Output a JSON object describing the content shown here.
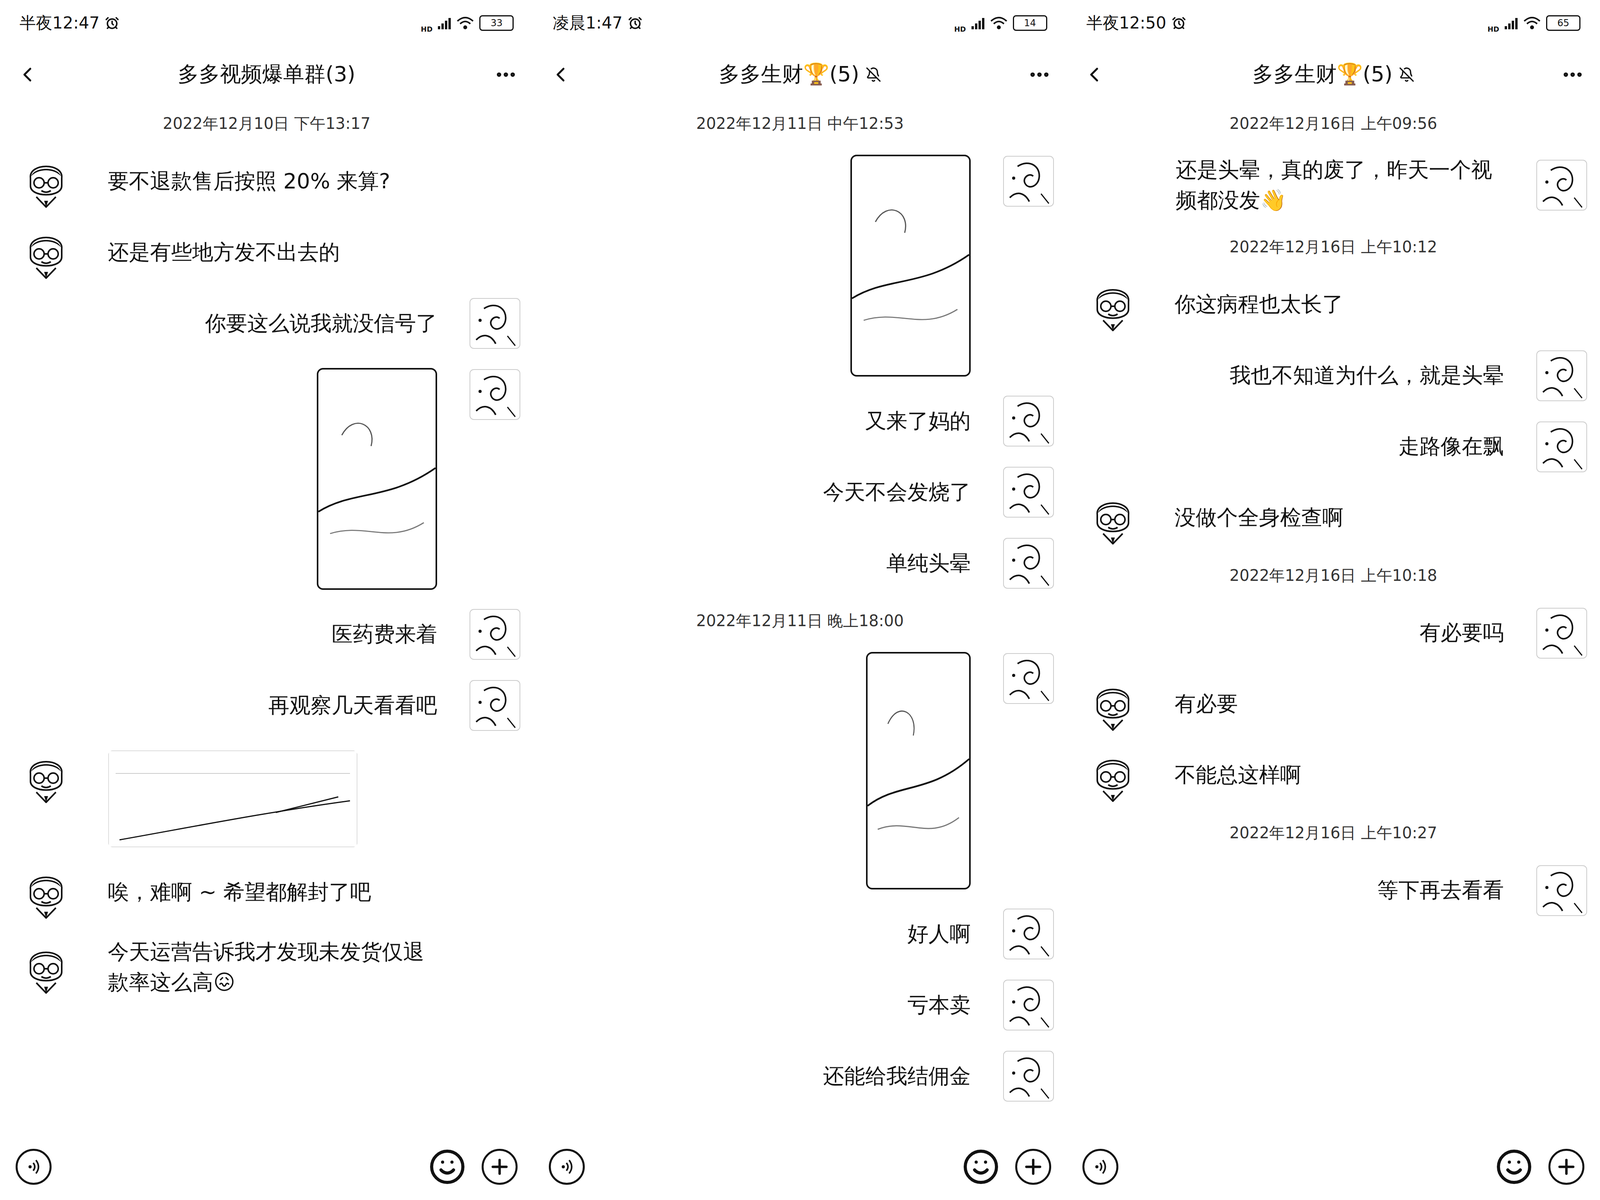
{
  "panels": [
    {
      "status_bar": {
        "time": "半夜12:47",
        "network": "HD",
        "battery": "33"
      },
      "title": "多多视频爆单群(3)",
      "muted": false,
      "messages": [
        {
          "kind": "time",
          "text": "2022年12月10日 下午13:17"
        },
        {
          "kind": "text",
          "side": "left",
          "text": "要不退款售后按照 20% 来算?"
        },
        {
          "kind": "text",
          "side": "left",
          "text": "还是有些地方发不出去的"
        },
        {
          "kind": "text",
          "side": "right",
          "text": "你要这么说我就没信号了"
        },
        {
          "kind": "photo",
          "side": "right"
        },
        {
          "kind": "text",
          "side": "right",
          "text": "医药费来着"
        },
        {
          "kind": "text",
          "side": "right",
          "text": "再观察几天看看吧"
        },
        {
          "kind": "chart",
          "side": "left"
        },
        {
          "kind": "text",
          "side": "left",
          "text": "唉，难啊 ~ 希望都解封了吧"
        },
        {
          "kind": "text",
          "side": "left",
          "text": "今天运营告诉我才发现未发货仅退款率这么高😖"
        }
      ]
    },
    {
      "status_bar": {
        "time": "凌晨1:47",
        "network": "HD",
        "battery": "14"
      },
      "title": "多多生财🏆(5)",
      "muted": true,
      "messages": [
        {
          "kind": "time",
          "text": "2022年12月11日 中午12:53"
        },
        {
          "kind": "photo",
          "side": "right"
        },
        {
          "kind": "text",
          "side": "right",
          "text": "又来了妈的"
        },
        {
          "kind": "text",
          "side": "right",
          "text": "今天不会发烧了"
        },
        {
          "kind": "text",
          "side": "right",
          "text": "单纯头晕"
        },
        {
          "kind": "time",
          "text": "2022年12月11日 晚上18:00"
        },
        {
          "kind": "screenshot",
          "side": "right"
        },
        {
          "kind": "text",
          "side": "right",
          "text": "好人啊"
        },
        {
          "kind": "text",
          "side": "right",
          "text": "亏本卖"
        },
        {
          "kind": "text",
          "side": "right",
          "text": "还能给我结佣金"
        }
      ]
    },
    {
      "status_bar": {
        "time": "半夜12:50",
        "network": "HD",
        "battery": "65"
      },
      "title": "多多生财🏆(5)",
      "muted": true,
      "messages": [
        {
          "kind": "time",
          "text": "2022年12月16日 上午09:56"
        },
        {
          "kind": "text",
          "side": "right",
          "text": "还是头晕，真的废了，昨天一个视频都没发👋"
        },
        {
          "kind": "time",
          "text": "2022年12月16日 上午10:12"
        },
        {
          "kind": "text",
          "side": "left",
          "text": "你这病程也太长了"
        },
        {
          "kind": "text",
          "side": "right",
          "text": "我也不知道为什么，就是头晕"
        },
        {
          "kind": "text",
          "side": "right",
          "text": "走路像在飘"
        },
        {
          "kind": "text",
          "side": "left",
          "text": "没做个全身检查啊"
        },
        {
          "kind": "time",
          "text": "2022年12月16日 上午10:18"
        },
        {
          "kind": "text",
          "side": "right",
          "text": "有必要吗"
        },
        {
          "kind": "text",
          "side": "left",
          "text": "有必要"
        },
        {
          "kind": "text",
          "side": "left",
          "text": "不能总这样啊"
        },
        {
          "kind": "time",
          "text": "2022年12月16日 上午10:27"
        },
        {
          "kind": "text",
          "side": "right",
          "text": "等下再去看看"
        }
      ]
    }
  ]
}
